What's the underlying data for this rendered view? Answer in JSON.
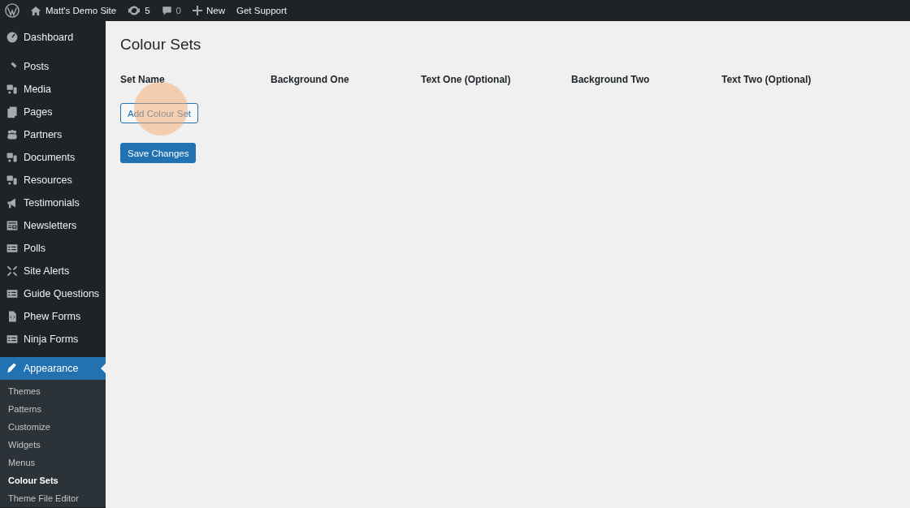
{
  "admin_bar": {
    "site_name": "Matt's Demo Site",
    "updates": "5",
    "comments": "0",
    "new": "New",
    "support": "Get Support"
  },
  "sidebar": {
    "items": [
      {
        "label": "Dashboard",
        "selected": false
      },
      {
        "label": "Posts",
        "selected": false
      },
      {
        "label": "Media",
        "selected": false
      },
      {
        "label": "Pages",
        "selected": false
      },
      {
        "label": "Partners",
        "selected": false
      },
      {
        "label": "Documents",
        "selected": false
      },
      {
        "label": "Resources",
        "selected": false
      },
      {
        "label": "Testimonials",
        "selected": false
      },
      {
        "label": "Newsletters",
        "selected": false
      },
      {
        "label": "Polls",
        "selected": false
      },
      {
        "label": "Site Alerts",
        "selected": false
      },
      {
        "label": "Guide Questions",
        "selected": false
      },
      {
        "label": "Phew Forms",
        "selected": false
      },
      {
        "label": "Ninja Forms",
        "selected": false
      },
      {
        "label": "Appearance",
        "selected": true
      }
    ],
    "submenu": [
      {
        "label": "Themes",
        "selected": false
      },
      {
        "label": "Patterns",
        "selected": false
      },
      {
        "label": "Customize",
        "selected": false
      },
      {
        "label": "Widgets",
        "selected": false
      },
      {
        "label": "Menus",
        "selected": false
      },
      {
        "label": "Colour Sets",
        "selected": true
      },
      {
        "label": "Theme File Editor",
        "selected": false
      }
    ]
  },
  "page": {
    "title": "Colour Sets",
    "table": {
      "columns": [
        "Set Name",
        "Background One",
        "Text One (Optional)",
        "Background Two",
        "Text Two (Optional)"
      ]
    },
    "add_button": "Add Colour Set",
    "save_button": "Save Changes",
    "click_marker": true
  }
}
